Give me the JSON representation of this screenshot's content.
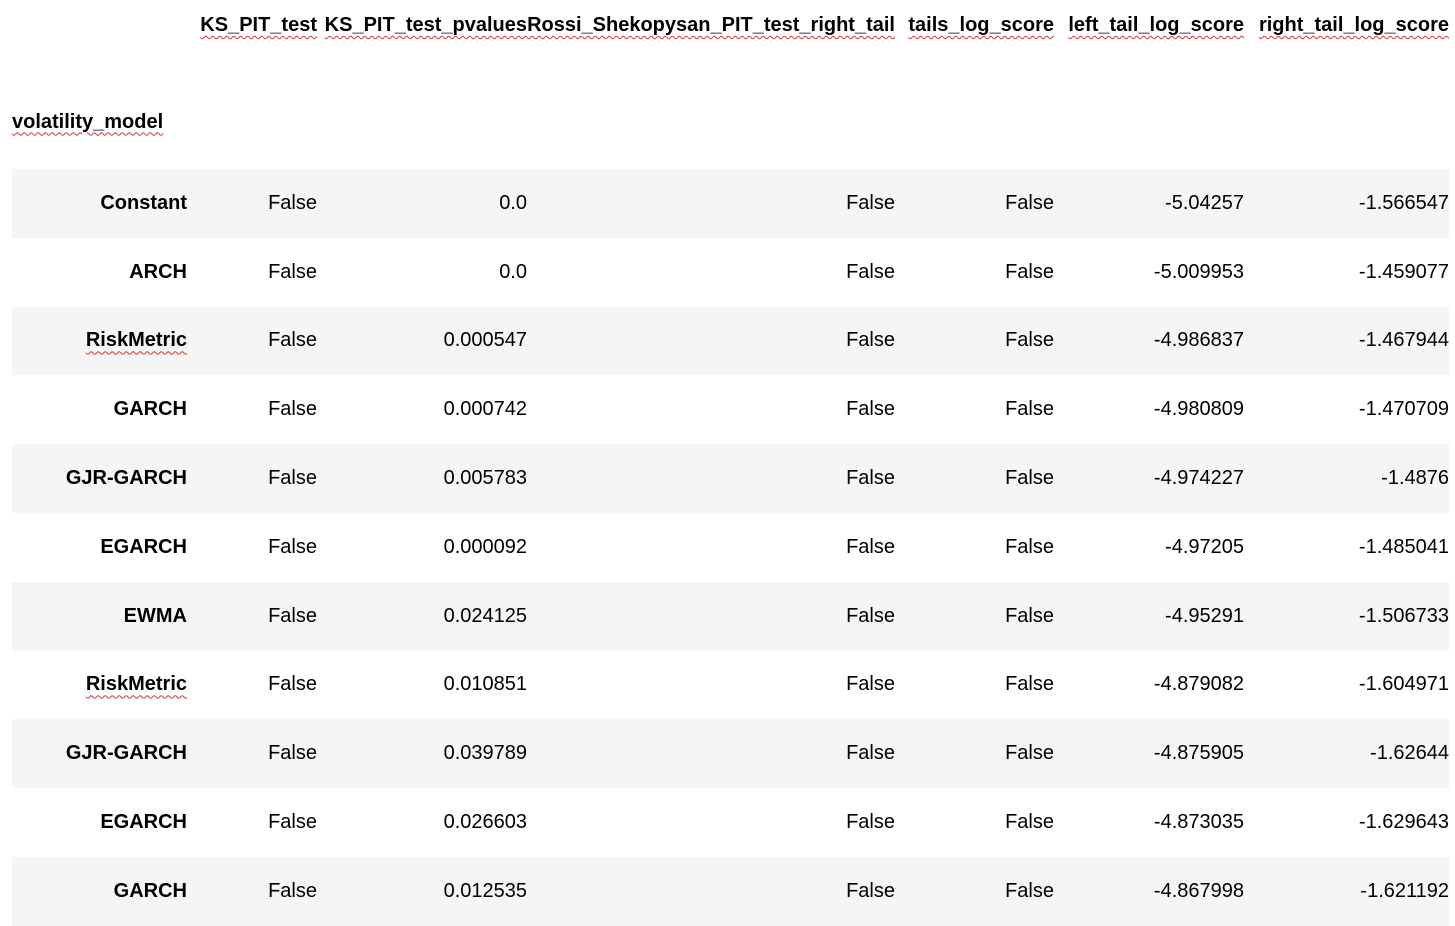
{
  "table": {
    "index_name": "volatility_model",
    "columns": [
      "KS_PIT_test",
      "KS_PIT_test_pvalues",
      "Rossi_Shekopysan_PIT_test_right_tail",
      "tails_log_score",
      "left_tail_log_score",
      "right_tail_log_score"
    ],
    "rows": [
      {
        "model": "Constant",
        "cells": [
          "False",
          "0.0",
          "False",
          "False",
          "-5.04257",
          "-1.566547"
        ]
      },
      {
        "model": "ARCH",
        "cells": [
          "False",
          "0.0",
          "False",
          "False",
          "-5.009953",
          "-1.459077"
        ]
      },
      {
        "model": "RiskMetric",
        "cells": [
          "False",
          "0.000547",
          "False",
          "False",
          "-4.986837",
          "-1.467944"
        ]
      },
      {
        "model": "GARCH",
        "cells": [
          "False",
          "0.000742",
          "False",
          "False",
          "-4.980809",
          "-1.470709"
        ]
      },
      {
        "model": "GJR-GARCH",
        "cells": [
          "False",
          "0.005783",
          "False",
          "False",
          "-4.974227",
          "-1.4876"
        ]
      },
      {
        "model": "EGARCH",
        "cells": [
          "False",
          "0.000092",
          "False",
          "False",
          "-4.97205",
          "-1.485041"
        ]
      },
      {
        "model": "EWMA",
        "cells": [
          "False",
          "0.024125",
          "False",
          "False",
          "-4.95291",
          "-1.506733"
        ]
      },
      {
        "model": "RiskMetric",
        "cells": [
          "False",
          "0.010851",
          "False",
          "False",
          "-4.879082",
          "-1.604971"
        ]
      },
      {
        "model": "GJR-GARCH",
        "cells": [
          "False",
          "0.039789",
          "False",
          "False",
          "-4.875905",
          "-1.62644"
        ]
      },
      {
        "model": "EGARCH",
        "cells": [
          "False",
          "0.026603",
          "False",
          "False",
          "-4.873035",
          "-1.629643"
        ]
      },
      {
        "model": "GARCH",
        "cells": [
          "False",
          "0.012535",
          "False",
          "False",
          "-4.867998",
          "-1.621192"
        ]
      }
    ]
  },
  "colors": {
    "stripe": "#f5f5f5",
    "background": "#ffffff",
    "spellcheck_underline": "#d13438"
  }
}
